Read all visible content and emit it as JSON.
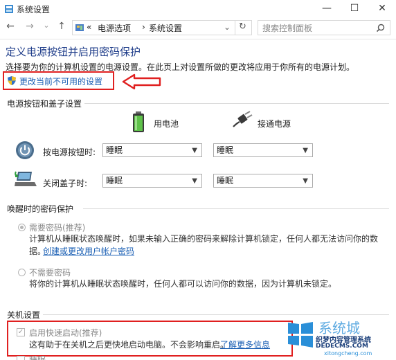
{
  "window": {
    "title": "系统设置",
    "minimize_glyph": "—",
    "maximize_glyph": "☐",
    "close_glyph": "✕"
  },
  "address": {
    "back_glyph": "←",
    "forward_glyph": "→",
    "recent_glyph": "⌄",
    "up_glyph": "↑",
    "crumb_prefix": "«",
    "crumbs": [
      "电源选项",
      "系统设置"
    ],
    "separator": "›",
    "dropdown_glyph": "⌄",
    "refresh_glyph": "↻",
    "search_placeholder": "搜索控制面板"
  },
  "content": {
    "title": "定义电源按钮并启用密码保护",
    "description": "选择要为你的计算机设置的电源设置。在此页上对设置所做的更改将应用于你所有的电源计划。",
    "change_link": "更改当前不可用的设置"
  },
  "power_buttons": {
    "section_title": "电源按钮和盖子设置",
    "battery_label": "用电池",
    "plugged_label": "接通电源",
    "rows": [
      {
        "label": "按电源按钮时:",
        "battery_value": "睡眠",
        "plugged_value": "睡眠"
      },
      {
        "label": "关闭盖子时:",
        "battery_value": "睡眠",
        "plugged_value": "睡眠"
      }
    ]
  },
  "wake_password": {
    "section_title": "唤醒时的密码保护",
    "require": {
      "label": "需要密码(推荐)",
      "desc_line1": "计算机从睡眠状态唤醒时，如果未输入正确的密码来解除计算机锁定，任何人都无法访问你的数",
      "desc_line2": "据。",
      "link": "创建或更改用户帐户密码",
      "selected": true
    },
    "no_require": {
      "label": "不需要密码",
      "desc": "将你的计算机从睡眠状态唤醒时，任何人都可以访问你的数据，因为计算机未锁定。",
      "selected": false
    }
  },
  "shutdown": {
    "section_title": "关机设置",
    "fast_startup_label": "启用快速启动(推荐)",
    "fast_startup_checked": true,
    "fast_startup_desc": "这有助于在关机之后更快地启动电脑。不会影响重启。",
    "learn_more": "了解更多信息",
    "sleep_label": "睡眠"
  },
  "watermark": {
    "brand": "系统城",
    "line1": "织梦内容管理系统",
    "line2": "DEDECMS.COM",
    "line3": "xitongcheng.com"
  },
  "colors": {
    "accent_link": "#1a5fb4",
    "title_blue": "#1f3d8a",
    "highlight_red": "#e02020"
  },
  "icons": [
    "settings-app-icon",
    "shield-icon",
    "battery-icon",
    "power-plug-icon",
    "power-button-icon",
    "laptop-lid-icon",
    "search-icon",
    "refresh-icon"
  ]
}
